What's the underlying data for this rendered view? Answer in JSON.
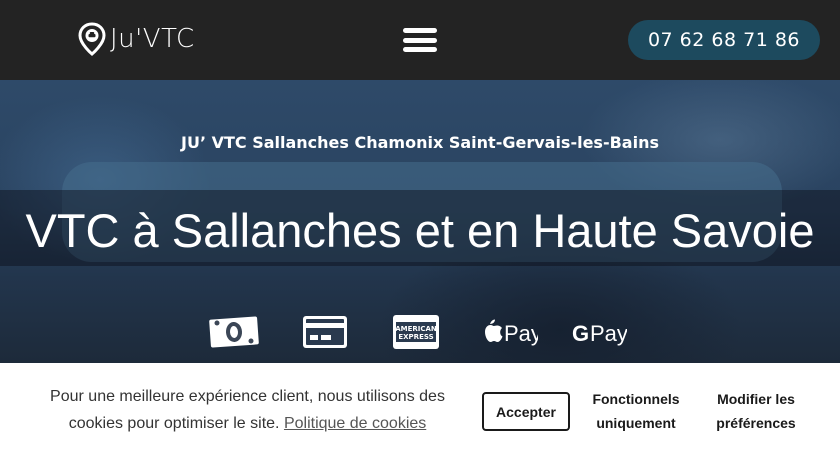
{
  "header": {
    "logo_text": "Ju'VTC",
    "phone": "07 62 68 71 86"
  },
  "hero": {
    "subtitle": "JU’ VTC Sallanches Chamonix Saint-Gervais-les-Bains",
    "title": "VTC à Sallanches et en Haute Savoie",
    "payment_methods": [
      {
        "icon": "cash-icon"
      },
      {
        "icon": "credit-card-icon"
      },
      {
        "icon": "american-express-icon",
        "text_top": "AMERICAN",
        "text_bottom": "EXPRESS"
      },
      {
        "icon": "apple-pay-icon",
        "text": "Pay"
      },
      {
        "icon": "google-pay-icon",
        "text": "Pay",
        "letter": "G"
      }
    ]
  },
  "cookie_banner": {
    "message": "Pour une meilleure expérience client, nous utilisons des cookies pour optimiser le site.",
    "policy_link": "Politique de cookies",
    "accept": "Accepter",
    "functional_line1": "Fonctionnels",
    "functional_line2": "uniquement",
    "prefs_line1": "Modifier les",
    "prefs_line2": "préférences"
  }
}
